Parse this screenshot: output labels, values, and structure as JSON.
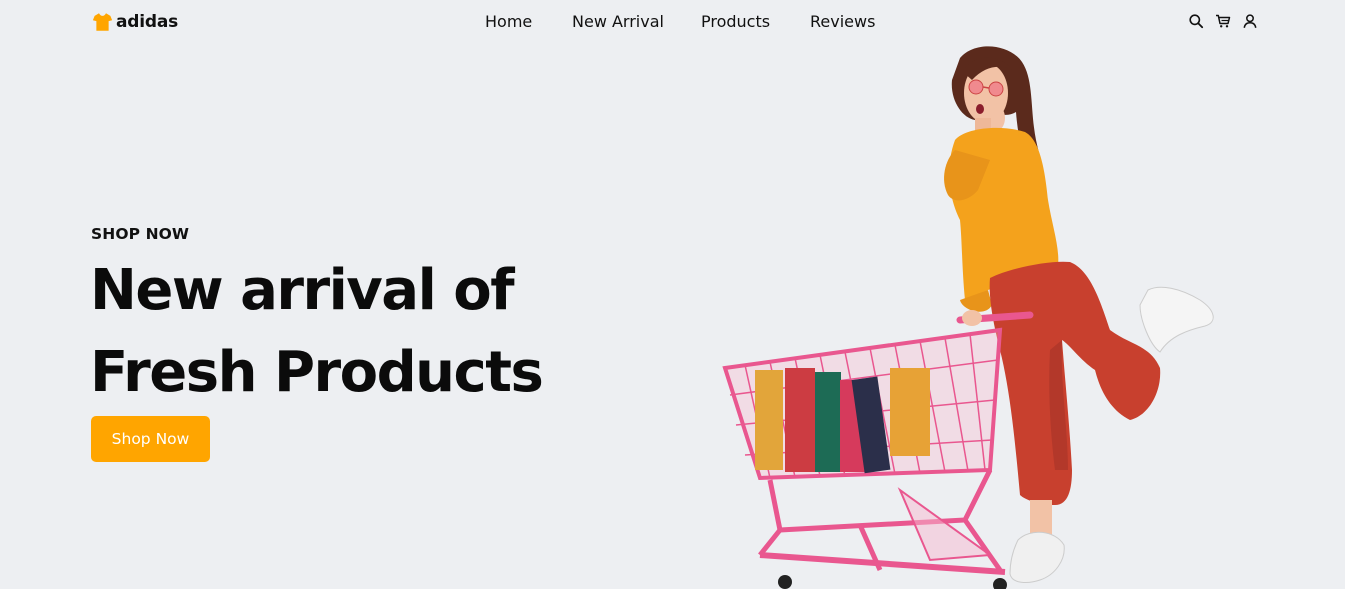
{
  "brand": {
    "name": "adidas",
    "logo_icon": "tshirt-icon",
    "accent": "#ffa500"
  },
  "nav": {
    "items": [
      {
        "label": "Home"
      },
      {
        "label": "New Arrival"
      },
      {
        "label": "Products"
      },
      {
        "label": "Reviews"
      }
    ]
  },
  "header_icons": [
    "search-icon",
    "cart-icon",
    "user-icon"
  ],
  "hero": {
    "eyebrow": "SHOP NOW",
    "headline_line1": "New arrival of",
    "headline_line2": "Fresh Products",
    "cta_label": "Shop Now",
    "image": "woman-with-shopping-cart"
  },
  "colors": {
    "background": "#edeff2",
    "cta": "#ffa500",
    "text": "#111111",
    "cart": "#e9578f",
    "shirt": "#f4a21c",
    "pants": "#c8402e"
  }
}
